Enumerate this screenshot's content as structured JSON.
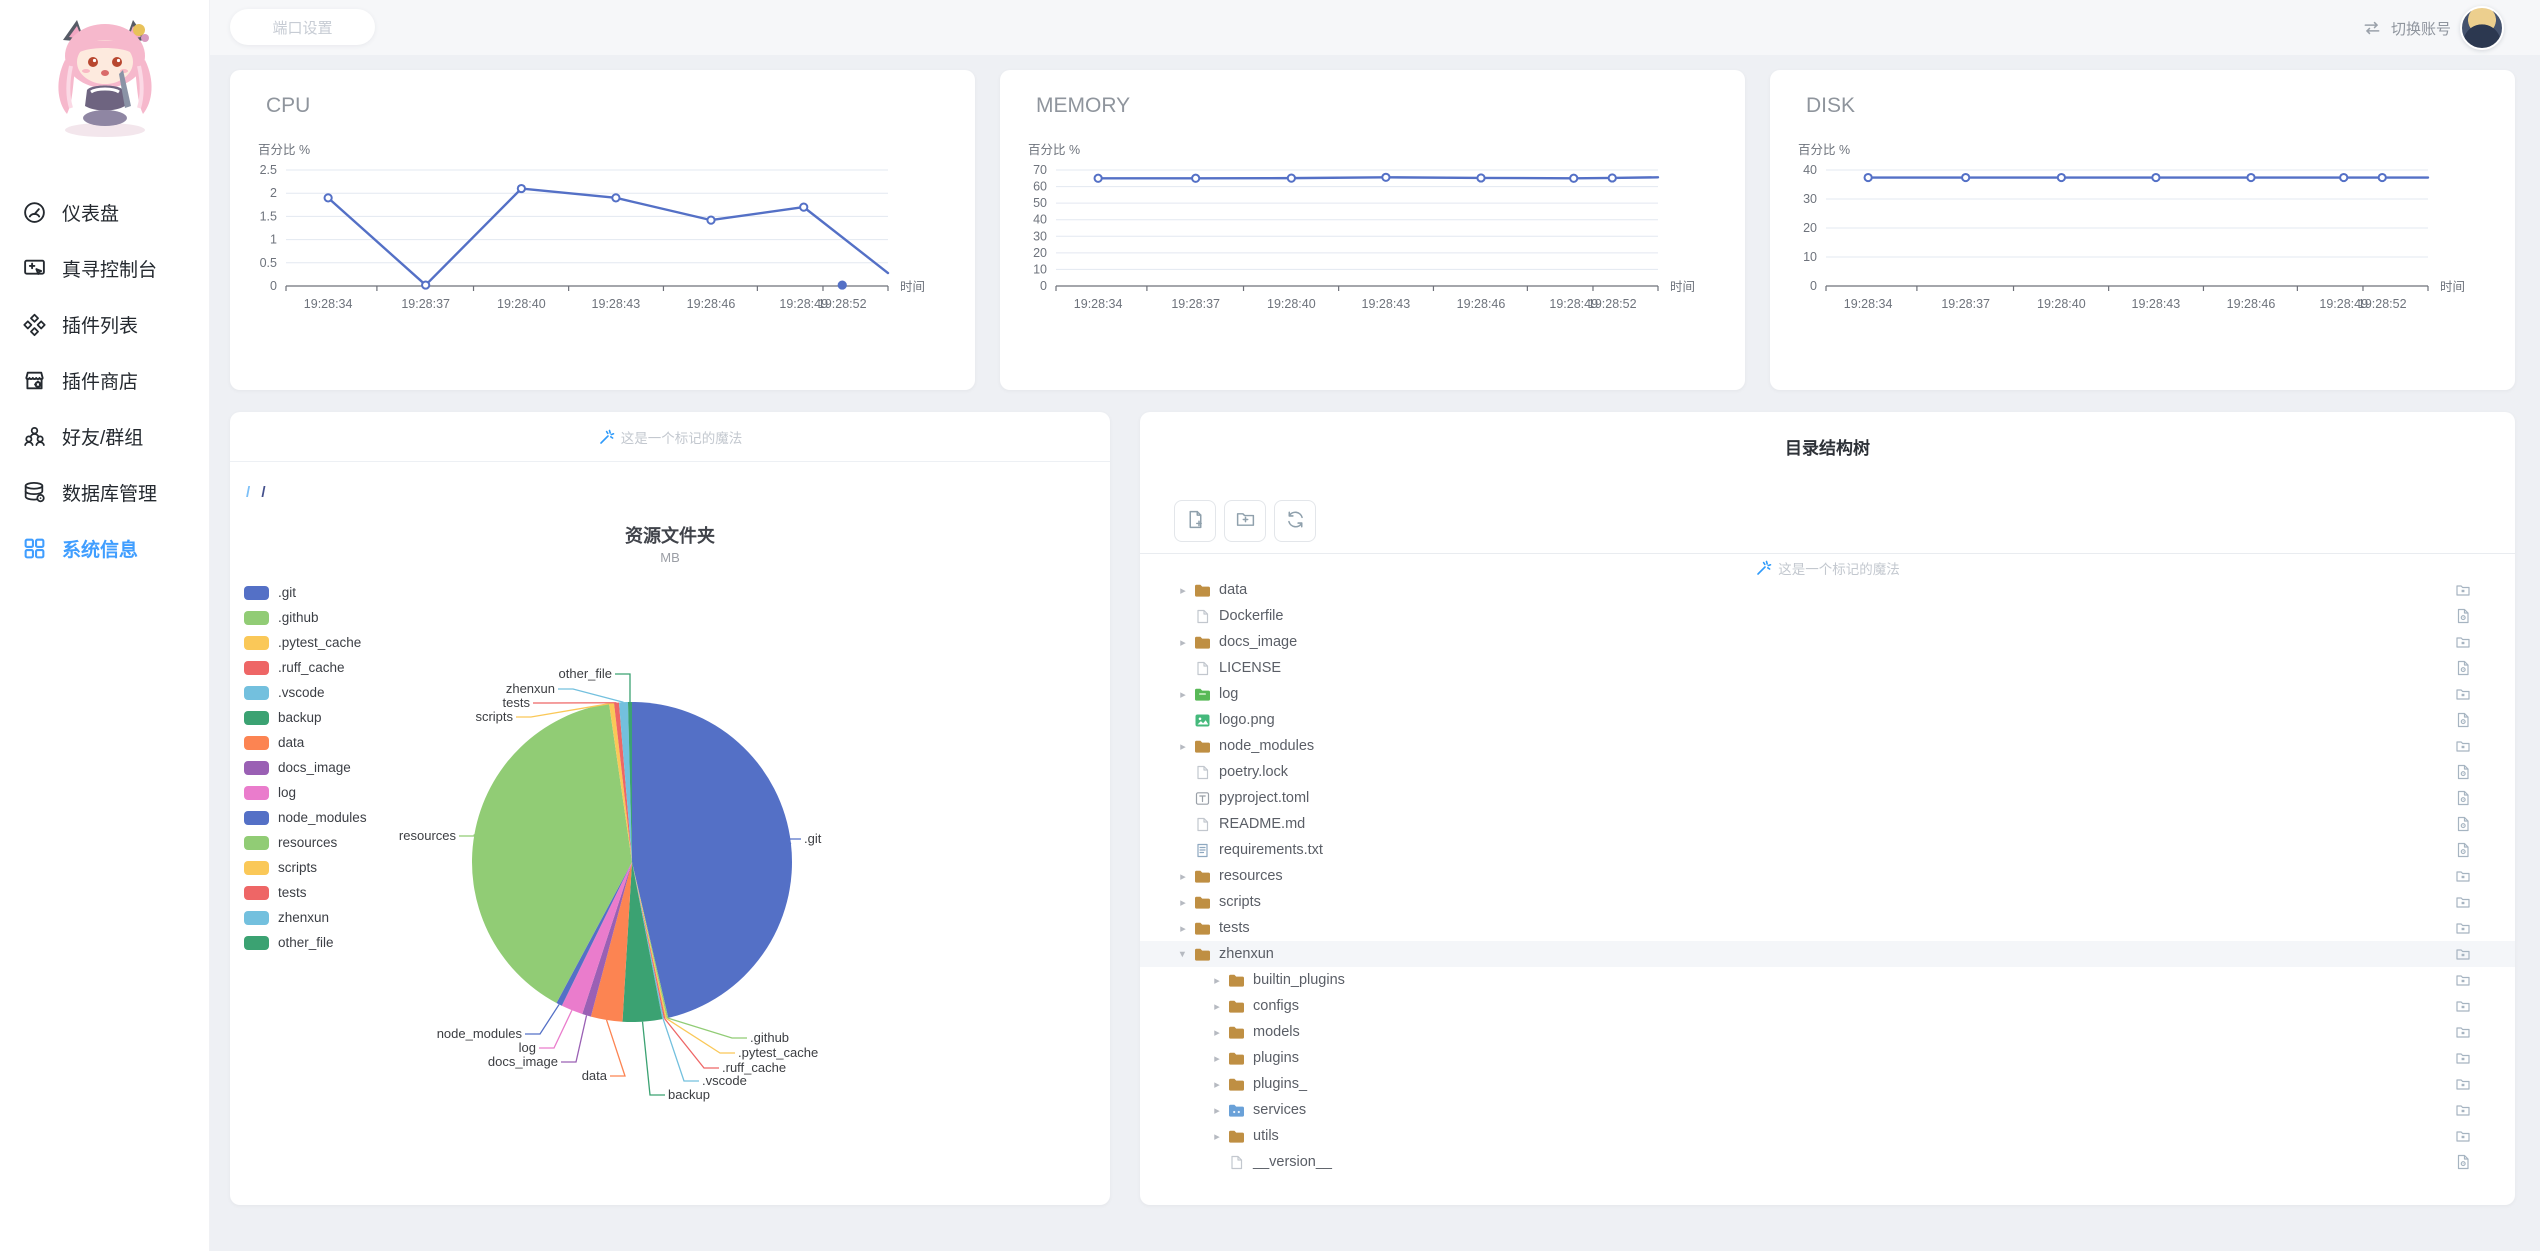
{
  "colors": {
    "accent": "#409eff",
    "line": "#5470c6",
    "folder": "#bf8f43"
  },
  "topbar": {
    "port_button": "端口设置",
    "switch_account": "切换账号"
  },
  "sidebar": {
    "items": [
      {
        "id": "dashboard",
        "label": "仪表盘",
        "icon": "dashboard-icon",
        "active": false
      },
      {
        "id": "console",
        "label": "真寻控制台",
        "icon": "console-icon",
        "active": false
      },
      {
        "id": "plugin-list",
        "label": "插件列表",
        "icon": "plugin-list-icon",
        "active": false
      },
      {
        "id": "plugin-store",
        "label": "插件商店",
        "icon": "plugin-store-icon",
        "active": false
      },
      {
        "id": "friends",
        "label": "好友/群组",
        "icon": "friends-icon",
        "active": false
      },
      {
        "id": "database",
        "label": "数据库管理",
        "icon": "database-icon",
        "active": false
      },
      {
        "id": "system-info",
        "label": "系统信息",
        "icon": "system-info-icon",
        "active": true
      }
    ]
  },
  "pie_card": {
    "magic_label": "这是一个标记的魔法",
    "breadcrumb_root": "/",
    "breadcrumb_current": "/"
  },
  "tree_card": {
    "title": "目录结构树",
    "magic_label": "这是一个标记的魔法",
    "toolbar": [
      {
        "id": "add-file",
        "icon": "file-plus-icon"
      },
      {
        "id": "add-folder",
        "icon": "folder-plus-icon"
      },
      {
        "id": "refresh",
        "icon": "refresh-icon"
      }
    ],
    "rows": [
      {
        "label": "data",
        "level": 0,
        "caret": "right",
        "icon": "folder",
        "trail": "folder",
        "highlighted": false
      },
      {
        "label": "Dockerfile",
        "level": 0,
        "caret": null,
        "icon": "file",
        "trail": "file",
        "highlighted": false
      },
      {
        "label": "docs_image",
        "level": 0,
        "caret": "right",
        "icon": "folder",
        "trail": "folder",
        "highlighted": false
      },
      {
        "label": "LICENSE",
        "level": 0,
        "caret": null,
        "icon": "file",
        "trail": "file",
        "highlighted": false
      },
      {
        "label": "log",
        "level": 0,
        "caret": "right",
        "icon": "folder-log",
        "trail": "folder",
        "highlighted": false
      },
      {
        "label": "logo.png",
        "level": 0,
        "caret": null,
        "icon": "image",
        "trail": "file",
        "highlighted": false
      },
      {
        "label": "node_modules",
        "level": 0,
        "caret": "right",
        "icon": "folder",
        "trail": "folder",
        "highlighted": false
      },
      {
        "label": "poetry.lock",
        "level": 0,
        "caret": null,
        "icon": "file",
        "trail": "file",
        "highlighted": false
      },
      {
        "label": "pyproject.toml",
        "level": 0,
        "caret": null,
        "icon": "toml",
        "trail": "file",
        "highlighted": false
      },
      {
        "label": "README.md",
        "level": 0,
        "caret": null,
        "icon": "file",
        "trail": "file",
        "highlighted": false
      },
      {
        "label": "requirements.txt",
        "level": 0,
        "caret": null,
        "icon": "txt",
        "trail": "file",
        "highlighted": false
      },
      {
        "label": "resources",
        "level": 0,
        "caret": "right",
        "icon": "folder",
        "trail": "folder",
        "highlighted": false
      },
      {
        "label": "scripts",
        "level": 0,
        "caret": "right",
        "icon": "folder",
        "trail": "folder",
        "highlighted": false
      },
      {
        "label": "tests",
        "level": 0,
        "caret": "right",
        "icon": "folder",
        "trail": "folder",
        "highlighted": false
      },
      {
        "label": "zhenxun",
        "level": 0,
        "caret": "down",
        "icon": "folder",
        "trail": "folder",
        "highlighted": true
      },
      {
        "label": "builtin_plugins",
        "level": 1,
        "caret": "right",
        "icon": "folder",
        "trail": "folder",
        "highlighted": false
      },
      {
        "label": "configs",
        "level": 1,
        "caret": "right",
        "icon": "folder",
        "trail": "folder",
        "highlighted": false
      },
      {
        "label": "models",
        "level": 1,
        "caret": "right",
        "icon": "folder",
        "trail": "folder",
        "highlighted": false
      },
      {
        "label": "plugins",
        "level": 1,
        "caret": "right",
        "icon": "folder",
        "trail": "folder",
        "highlighted": false
      },
      {
        "label": "plugins_",
        "level": 1,
        "caret": "right",
        "icon": "folder",
        "trail": "folder",
        "highlighted": false
      },
      {
        "label": "services",
        "level": 1,
        "caret": "right",
        "icon": "folder-services",
        "trail": "folder",
        "highlighted": false
      },
      {
        "label": "utils",
        "level": 1,
        "caret": "right",
        "icon": "folder",
        "trail": "folder",
        "highlighted": false
      },
      {
        "label": "__version__",
        "level": 1,
        "caret": null,
        "icon": "file",
        "trail": "file",
        "highlighted": false
      }
    ]
  },
  "chart_data": [
    {
      "type": "line",
      "title": "CPU",
      "ylabel": "百分比 %",
      "xlabel": "时间",
      "line_color": "#5470c6",
      "ylim": [
        0,
        2.5
      ],
      "yticks": [
        "0",
        "0.5",
        "1",
        "1.5",
        "2",
        "2.5"
      ],
      "x_labels": [
        "19:28:34",
        "19:28:37",
        "19:28:40",
        "19:28:43",
        "19:28:46",
        "19:28:49",
        "19:28:52"
      ],
      "x_label_fractions": [
        0.07,
        0.232,
        0.391,
        0.548,
        0.706,
        0.86,
        0.924
      ],
      "line_points": [
        {
          "f": 0.07,
          "v": 1.9
        },
        {
          "f": 0.232,
          "v": 0.02
        },
        {
          "f": 0.391,
          "v": 2.1
        },
        {
          "f": 0.548,
          "v": 1.9
        },
        {
          "f": 0.706,
          "v": 1.42
        },
        {
          "f": 0.86,
          "v": 1.7
        },
        {
          "f": 1.0,
          "v": 0.28
        }
      ],
      "markers": [
        {
          "f": 0.07,
          "v": 1.9,
          "filled": false
        },
        {
          "f": 0.232,
          "v": 0.02,
          "filled": false
        },
        {
          "f": 0.391,
          "v": 2.1,
          "filled": false
        },
        {
          "f": 0.548,
          "v": 1.9,
          "filled": false
        },
        {
          "f": 0.706,
          "v": 1.42,
          "filled": false
        },
        {
          "f": 0.86,
          "v": 1.7,
          "filled": false
        },
        {
          "f": 0.924,
          "v": 0.02,
          "filled": true
        }
      ]
    },
    {
      "type": "line",
      "title": "MEMORY",
      "ylabel": "百分比 %",
      "xlabel": "时间",
      "line_color": "#5470c6",
      "ylim": [
        0,
        70
      ],
      "yticks": [
        "0",
        "10",
        "20",
        "30",
        "40",
        "50",
        "60",
        "70"
      ],
      "x_labels": [
        "19:28:34",
        "19:28:37",
        "19:28:40",
        "19:28:43",
        "19:28:46",
        "19:28:49",
        "19:28:52"
      ],
      "x_label_fractions": [
        0.07,
        0.232,
        0.391,
        0.548,
        0.706,
        0.86,
        0.924
      ],
      "line_points": [
        {
          "f": 0.07,
          "v": 65
        },
        {
          "f": 0.232,
          "v": 65
        },
        {
          "f": 0.391,
          "v": 65.1
        },
        {
          "f": 0.548,
          "v": 65.6
        },
        {
          "f": 0.706,
          "v": 65.2
        },
        {
          "f": 0.86,
          "v": 65
        },
        {
          "f": 0.924,
          "v": 65.2
        },
        {
          "f": 1.0,
          "v": 65.6
        }
      ],
      "markers": [
        {
          "f": 0.07,
          "v": 65,
          "filled": false
        },
        {
          "f": 0.232,
          "v": 65,
          "filled": false
        },
        {
          "f": 0.391,
          "v": 65.1,
          "filled": false
        },
        {
          "f": 0.548,
          "v": 65.6,
          "filled": false
        },
        {
          "f": 0.706,
          "v": 65.2,
          "filled": false
        },
        {
          "f": 0.86,
          "v": 65,
          "filled": false
        },
        {
          "f": 0.924,
          "v": 65.2,
          "filled": false
        }
      ]
    },
    {
      "type": "line",
      "title": "DISK",
      "ylabel": "百分比 %",
      "xlabel": "时间",
      "line_color": "#5470c6",
      "ylim": [
        0,
        40
      ],
      "yticks": [
        "0",
        "10",
        "20",
        "30",
        "40"
      ],
      "x_labels": [
        "19:28:34",
        "19:28:37",
        "19:28:40",
        "19:28:43",
        "19:28:46",
        "19:28:49",
        "19:28:52"
      ],
      "x_label_fractions": [
        0.07,
        0.232,
        0.391,
        0.548,
        0.706,
        0.86,
        0.924
      ],
      "line_points": [
        {
          "f": 0.07,
          "v": 37.4
        },
        {
          "f": 0.232,
          "v": 37.4
        },
        {
          "f": 0.391,
          "v": 37.4
        },
        {
          "f": 0.548,
          "v": 37.4
        },
        {
          "f": 0.706,
          "v": 37.4
        },
        {
          "f": 0.86,
          "v": 37.4
        },
        {
          "f": 0.924,
          "v": 37.4
        },
        {
          "f": 1.0,
          "v": 37.4
        }
      ],
      "markers": [
        {
          "f": 0.07,
          "v": 37.4,
          "filled": false
        },
        {
          "f": 0.232,
          "v": 37.4,
          "filled": false
        },
        {
          "f": 0.391,
          "v": 37.4,
          "filled": false
        },
        {
          "f": 0.548,
          "v": 37.4,
          "filled": false
        },
        {
          "f": 0.706,
          "v": 37.4,
          "filled": false
        },
        {
          "f": 0.86,
          "v": 37.4,
          "filled": false
        },
        {
          "f": 0.924,
          "v": 37.4,
          "filled": false
        }
      ]
    },
    {
      "type": "pie",
      "title": "资源文件夹",
      "subtitle": "MB",
      "slices": [
        {
          "name": ".git",
          "share_pct": 46.5,
          "color": "#5470c6"
        },
        {
          "name": ".github",
          "share_pct": 0.15,
          "color": "#91cc75"
        },
        {
          "name": ".pytest_cache",
          "share_pct": 0.15,
          "color": "#fac858"
        },
        {
          "name": ".ruff_cache",
          "share_pct": 0.15,
          "color": "#ee6666"
        },
        {
          "name": ".vscode",
          "share_pct": 0.15,
          "color": "#73c0de"
        },
        {
          "name": "backup",
          "share_pct": 4.0,
          "color": "#3ba272"
        },
        {
          "name": "data",
          "share_pct": 3.2,
          "color": "#fc8452"
        },
        {
          "name": "docs_image",
          "share_pct": 0.9,
          "color": "#9a60b4"
        },
        {
          "name": "log",
          "share_pct": 2.2,
          "color": "#ea7ccc"
        },
        {
          "name": "node_modules",
          "share_pct": 0.6,
          "color": "#5470c6"
        },
        {
          "name": "resources",
          "share_pct": 40.0,
          "color": "#91cc75"
        },
        {
          "name": "scripts",
          "share_pct": 0.5,
          "color": "#fac858"
        },
        {
          "name": "tests",
          "share_pct": 0.5,
          "color": "#ee6666"
        },
        {
          "name": "zhenxun",
          "share_pct": 0.9,
          "color": "#73c0de"
        },
        {
          "name": "other_file",
          "share_pct": 0.4,
          "color": "#3ba272"
        }
      ]
    }
  ]
}
